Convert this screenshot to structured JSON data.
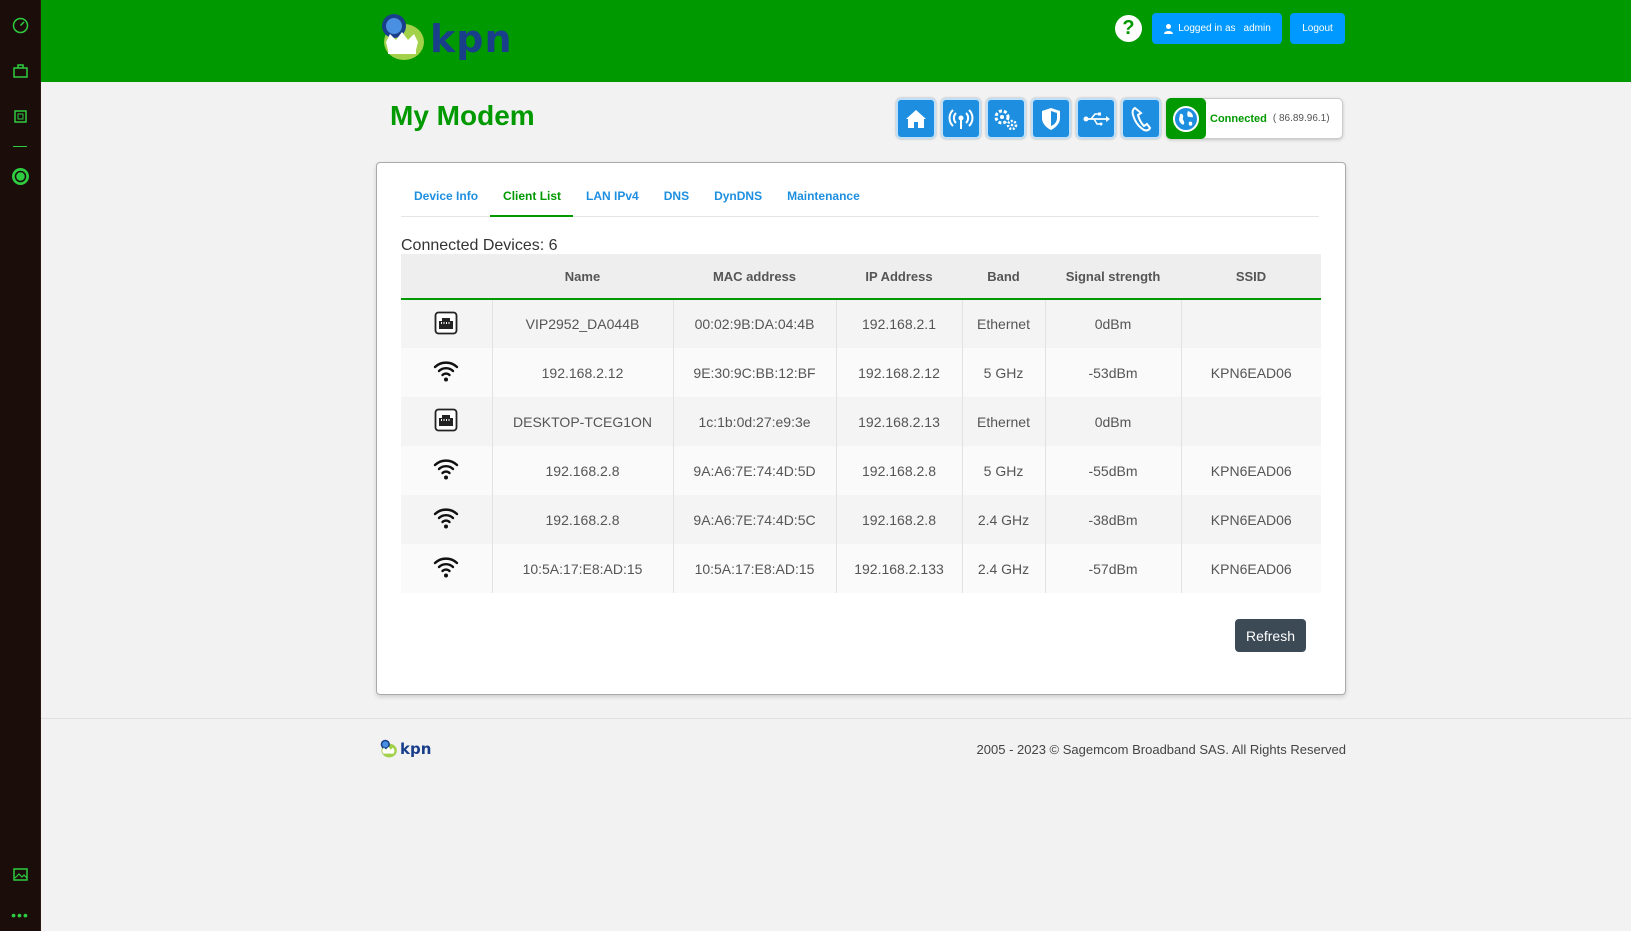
{
  "brand": {
    "logo_text": "kpn",
    "primary": "#009900",
    "accent": "#0099ff"
  },
  "header": {
    "help_label": "?",
    "user_prefix": "Logged in as",
    "user_name": "admin",
    "logout_label": "Logout"
  },
  "page": {
    "title": "My Modem",
    "connection_status": "Connected",
    "connection_ip": "( 86.89.96.1)"
  },
  "status_icons": [
    "home-icon",
    "wireless-icon",
    "settings-icon",
    "shield-icon",
    "usb-icon",
    "phone-icon",
    "globe-icon"
  ],
  "tabs": [
    {
      "label": "Device Info",
      "active": false
    },
    {
      "label": "Client List",
      "active": true
    },
    {
      "label": "LAN IPv4",
      "active": false
    },
    {
      "label": "DNS",
      "active": false
    },
    {
      "label": "DynDNS",
      "active": false
    },
    {
      "label": "Maintenance",
      "active": false
    }
  ],
  "clients": {
    "count_label": "Connected Devices: 6",
    "columns": [
      "",
      "Name",
      "MAC address",
      "IP Address",
      "Band",
      "Signal strength",
      "SSID"
    ],
    "rows": [
      {
        "type": "ethernet",
        "name": "VIP2952_DA044B",
        "mac": "00:02:9B:DA:04:4B",
        "ip": "192.168.2.1",
        "band": "Ethernet",
        "signal": "0dBm",
        "ssid": ""
      },
      {
        "type": "wifi",
        "name": "192.168.2.12",
        "mac": "9E:30:9C:BB:12:BF",
        "ip": "192.168.2.12",
        "band": "5 GHz",
        "signal": "-53dBm",
        "ssid": "KPN6EAD06"
      },
      {
        "type": "ethernet",
        "name": "DESKTOP-TCEG1ON",
        "mac": "1c:1b:0d:27:e9:3e",
        "ip": "192.168.2.13",
        "band": "Ethernet",
        "signal": "0dBm",
        "ssid": ""
      },
      {
        "type": "wifi",
        "name": "192.168.2.8",
        "mac": "9A:A6:7E:74:4D:5D",
        "ip": "192.168.2.8",
        "band": "5 GHz",
        "signal": "-55dBm",
        "ssid": "KPN6EAD06"
      },
      {
        "type": "wifi",
        "name": "192.168.2.8",
        "mac": "9A:A6:7E:74:4D:5C",
        "ip": "192.168.2.8",
        "band": "2.4 GHz",
        "signal": "-38dBm",
        "ssid": "KPN6EAD06"
      },
      {
        "type": "wifi",
        "name": "10:5A:17:E8:AD:15",
        "mac": "10:5A:17:E8:AD:15",
        "ip": "192.168.2.133",
        "band": "2.4 GHz",
        "signal": "-57dBm",
        "ssid": "KPN6EAD06"
      }
    ],
    "refresh_label": "Refresh"
  },
  "footer": {
    "logo_text": "kpn",
    "copyright": "2005 - 2023 © Sagemcom Broadband SAS. All Rights Reserved"
  },
  "rail_icons": [
    "speedometer-icon",
    "bag-icon",
    "chip-icon",
    "whatsapp-icon",
    "gallery-icon",
    "more-icon"
  ]
}
